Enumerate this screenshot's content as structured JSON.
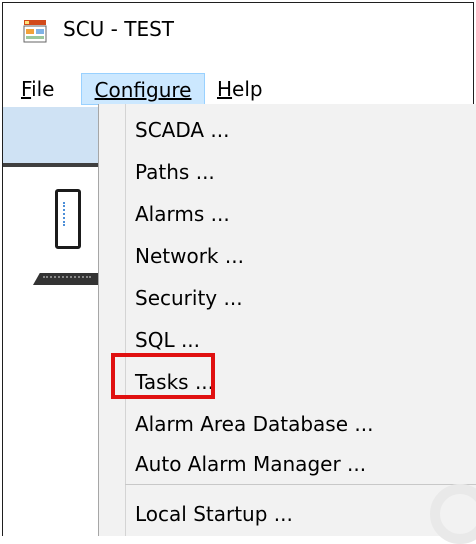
{
  "window": {
    "title": "SCU - TEST",
    "icon": "scu-app-icon"
  },
  "menubar": {
    "items": [
      {
        "label": "File",
        "mnemonic": "F",
        "rest": "ile"
      },
      {
        "label": "Configure",
        "mnemonic": "C",
        "rest": "onfigure",
        "state": "open"
      },
      {
        "label": "Help",
        "mnemonic": "H",
        "rest": "elp"
      }
    ]
  },
  "configure_menu": {
    "items": [
      {
        "label": "SCADA ..."
      },
      {
        "label": "Paths ..."
      },
      {
        "label": "Alarms ..."
      },
      {
        "label": "Network ..."
      },
      {
        "label": "Security ..."
      },
      {
        "label": "SQL ..."
      },
      {
        "label": "Tasks ...",
        "highlighted": true
      },
      {
        "label": "Alarm Area Database ..."
      },
      {
        "label": "Auto Alarm Manager ..."
      },
      {
        "label": "Local Startup ..."
      }
    ]
  },
  "colors": {
    "menu_active_bg": "#cce8ff",
    "menu_active_border": "#99d1ff",
    "dropdown_bg": "#f2f2f2",
    "highlight_red": "#e01010"
  }
}
